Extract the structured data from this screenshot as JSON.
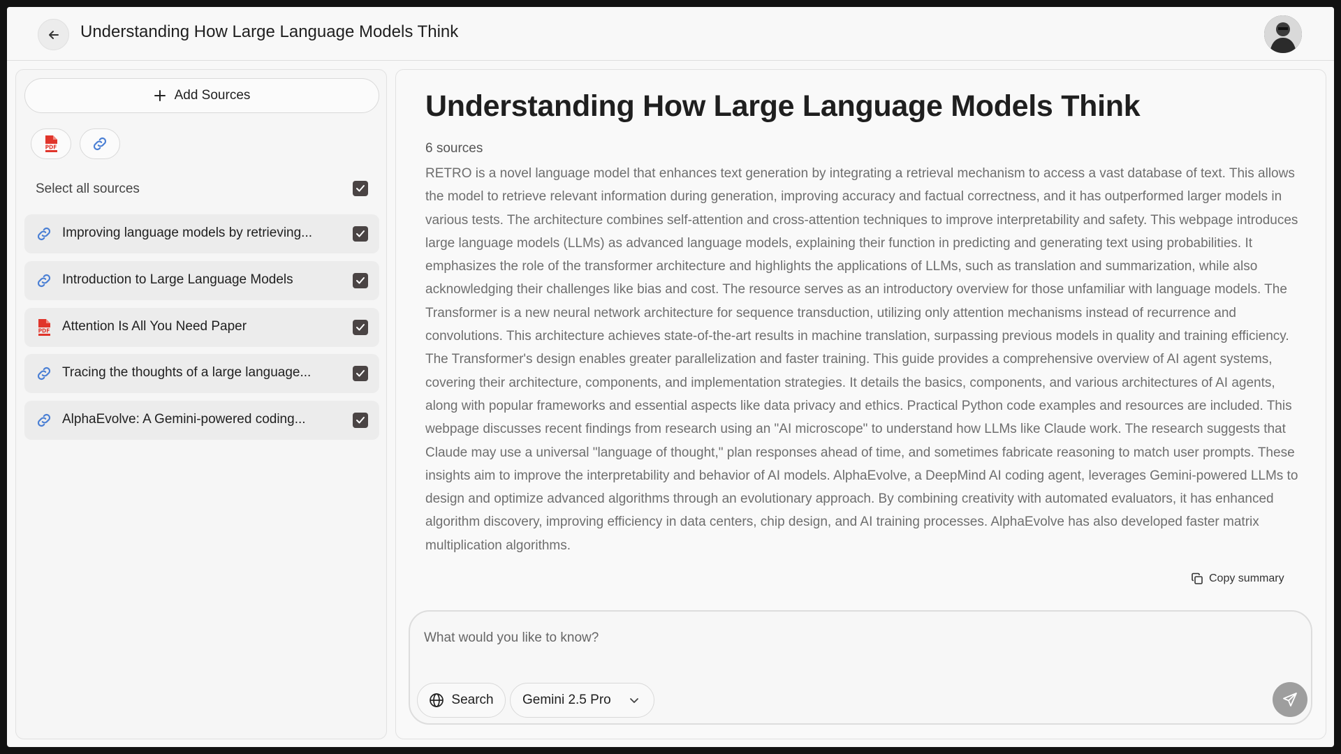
{
  "header": {
    "title": "Understanding How Large Language Models Think",
    "back_icon": "arrow-left-icon",
    "avatar": "user-avatar"
  },
  "sidebar": {
    "add_sources_label": "Add Sources",
    "source_types": [
      {
        "icon": "pdf-icon",
        "label": "PDF"
      },
      {
        "icon": "link-icon"
      }
    ],
    "select_all_label": "Select all sources",
    "select_all_checked": true,
    "items": [
      {
        "label": "Improving language models by retrieving...",
        "icon": "link-icon",
        "checked": true
      },
      {
        "label": "Introduction to Large Language Models",
        "icon": "link-icon",
        "checked": true
      },
      {
        "label": "Attention Is All You Need Paper",
        "icon": "pdf-icon",
        "checked": true
      },
      {
        "label": "Tracing the thoughts of a large language...",
        "icon": "link-icon",
        "checked": true
      },
      {
        "label": "AlphaEvolve: A Gemini-powered coding...",
        "icon": "link-icon",
        "checked": true
      }
    ]
  },
  "main": {
    "title": "Understanding How Large Language Models Think",
    "source_count": "6 sources",
    "summary": "RETRO is a novel language model that enhances text generation by integrating a retrieval mechanism to access a vast database of text. This allows the model to retrieve relevant information during generation, improving accuracy and factual correctness, and it has outperformed larger models in various tests. The architecture combines self-attention and cross-attention techniques to improve interpretability and safety. This webpage introduces large language models (LLMs) as advanced language models, explaining their function in predicting and generating text using probabilities. It emphasizes the role of the transformer architecture and highlights the applications of LLMs, such as translation and summarization, while also acknowledging their challenges like bias and cost. The resource serves as an introductory overview for those unfamiliar with language models. The Transformer is a new neural network architecture for sequence transduction, utilizing only attention mechanisms instead of recurrence and convolutions. This architecture achieves state-of-the-art results in machine translation, surpassing previous models in quality and training efficiency. The Transformer's design enables greater parallelization and faster training. This guide provides a comprehensive overview of AI agent systems, covering their architecture, components, and implementation strategies. It details the basics, components, and various architectures of AI agents, along with popular frameworks and essential aspects like data privacy and ethics. Practical Python code examples and resources are included. This webpage discusses recent findings from research using an \"AI microscope\" to understand how LLMs like Claude work. The research suggests that Claude may use a universal \"language of thought,\" plan responses ahead of time, and sometimes fabricate reasoning to match user prompts. These insights aim to improve the interpretability and behavior of AI models. AlphaEvolve, a DeepMind AI coding agent, leverages Gemini-powered LLMs to design and optimize advanced algorithms through an evolutionary approach. By combining creativity with automated evaluators, it has enhanced algorithm discovery, improving efficiency in data centers, chip design, and AI training processes. AlphaEvolve has also developed faster matrix multiplication algorithms.",
    "copy_summary_label": "Copy summary"
  },
  "chat": {
    "placeholder": "What would you like to know?",
    "value": "",
    "search_label": "Search",
    "model_label": "Gemini 2.5 Pro"
  },
  "colors": {
    "checkbox": "#4a4444",
    "link_icon": "#4a7fd4",
    "pdf_icon": "#e0352b",
    "send_button": "#9e9e9e"
  }
}
